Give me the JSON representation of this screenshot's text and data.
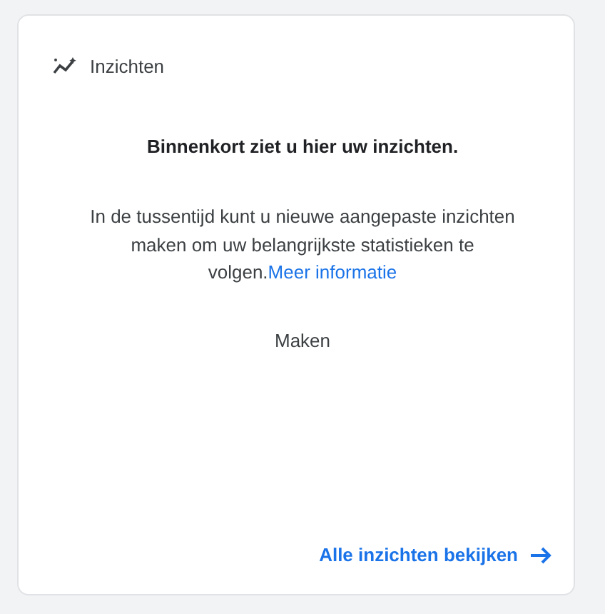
{
  "card": {
    "title": "Inzichten",
    "heading": "Binnenkort ziet u hier uw inzichten.",
    "body": "In de tussentijd kunt u nieuwe aangepaste inzichten maken om uw belangrijkste statistieken te volgen.",
    "body_link": "Meer informatie",
    "create_button": "Maken",
    "footer_link": "Alle inzichten bekijken"
  }
}
